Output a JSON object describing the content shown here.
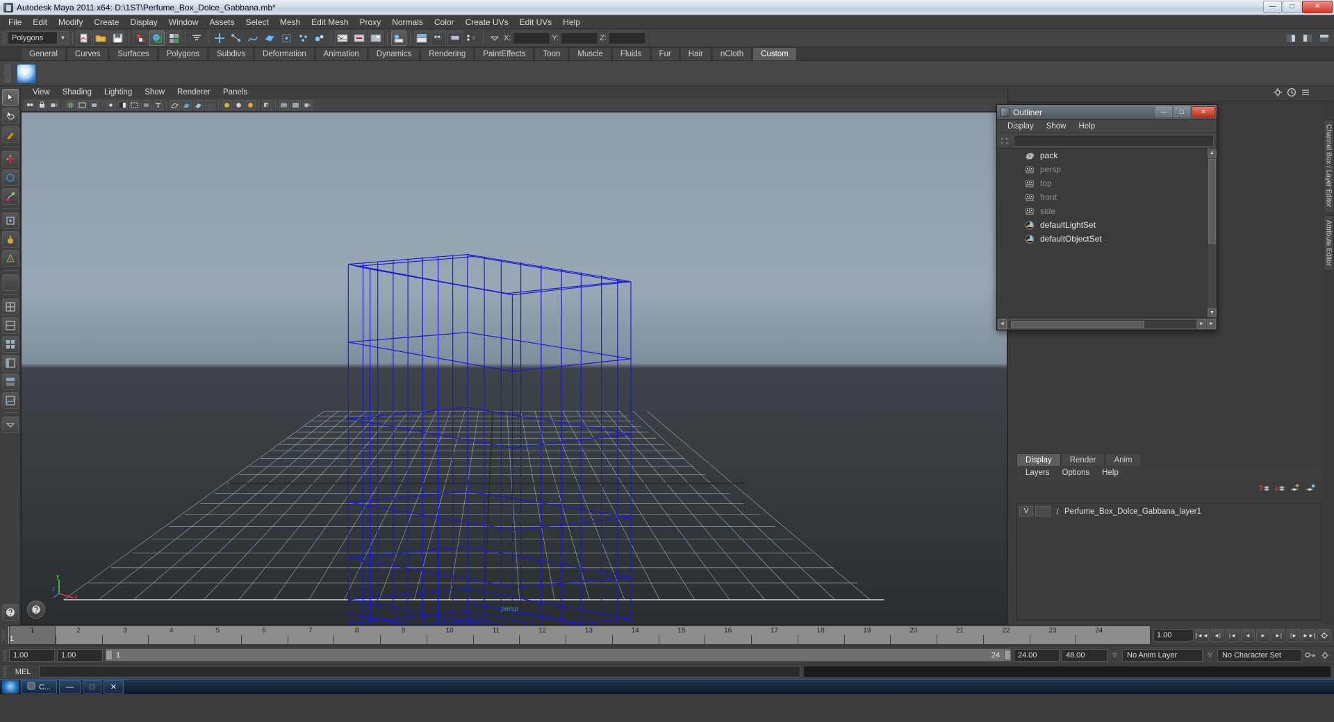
{
  "window": {
    "title": "Autodesk Maya 2011 x64: D:\\1ST\\Perfume_Box_Dolce_Gabbana.mb*",
    "app_icon": "maya-icon",
    "minimize": "—",
    "maximize": "□",
    "close": "✕"
  },
  "menubar": {
    "items": [
      "File",
      "Edit",
      "Modify",
      "Create",
      "Display",
      "Window",
      "Assets",
      "Select",
      "Mesh",
      "Edit Mesh",
      "Proxy",
      "Normals",
      "Color",
      "Create UVs",
      "Edit UVs",
      "Help"
    ]
  },
  "statusline": {
    "mode_menu": {
      "value": "Polygons",
      "arrow": "▼"
    },
    "coordinates": [
      {
        "label": "X:",
        "value": ""
      },
      {
        "label": "Y:",
        "value": ""
      },
      {
        "label": "Z:",
        "value": ""
      }
    ]
  },
  "shelf": {
    "tabs": [
      "General",
      "Curves",
      "Surfaces",
      "Polygons",
      "Subdivs",
      "Deformation",
      "Animation",
      "Dynamics",
      "Rendering",
      "PaintEffects",
      "Toon",
      "Muscle",
      "Fluids",
      "Fur",
      "Hair",
      "nCloth",
      "Custom"
    ],
    "active_tab": "Custom",
    "buttons": [
      {
        "name": "custom-check-button",
        "glyph": "✓"
      }
    ]
  },
  "viewport": {
    "menus": [
      "View",
      "Shading",
      "Lighting",
      "Show",
      "Renderer",
      "Panels"
    ],
    "camera_label": "persp",
    "axis": {
      "x": "x",
      "y": "y",
      "z": "z"
    },
    "object_color": "#1718d8",
    "grid_color": "#9aa7b4",
    "bg_top": "#8e9cab",
    "bg_bottom": "#2a2e31"
  },
  "outliner": {
    "title": "Outliner",
    "window_buttons": {
      "minimize": "—",
      "maximize": "□",
      "close": "✕"
    },
    "menus": [
      "Display",
      "Show",
      "Help"
    ],
    "search_value": "",
    "items": [
      {
        "label": "pack",
        "icon": "mesh-icon",
        "dim": false
      },
      {
        "label": "persp",
        "icon": "camera-icon",
        "dim": true
      },
      {
        "label": "top",
        "icon": "camera-icon",
        "dim": true
      },
      {
        "label": "front",
        "icon": "camera-icon",
        "dim": true
      },
      {
        "label": "side",
        "icon": "camera-icon",
        "dim": true
      },
      {
        "label": "defaultLightSet",
        "icon": "set-icon",
        "dim": false
      },
      {
        "label": "defaultObjectSet",
        "icon": "set-icon",
        "dim": false
      }
    ],
    "scroll_up": "▲",
    "scroll_down": "▼",
    "scroll_left": "◄",
    "scroll_right": "►"
  },
  "right_panel": {
    "vertical_tabs": [
      "Channel Box / Layer Editor",
      "Attribute Editor"
    ]
  },
  "layer_editor": {
    "tabs": [
      "Display",
      "Render",
      "Anim"
    ],
    "active_tab": "Display",
    "menus": [
      "Layers",
      "Options",
      "Help"
    ],
    "layers": [
      {
        "visibility": "V",
        "shading": "",
        "name": "Perfume_Box_Dolce_Gabbana_layer1"
      }
    ]
  },
  "timeline": {
    "ticks": [
      "1",
      "2",
      "3",
      "4",
      "5",
      "6",
      "7",
      "8",
      "9",
      "10",
      "11",
      "12",
      "13",
      "14",
      "15",
      "16",
      "17",
      "18",
      "19",
      "20",
      "21",
      "22",
      "23",
      "24"
    ],
    "current_frame": "1",
    "current_frame_field": "1.00",
    "playback_buttons": [
      "|◄◄",
      "◄|",
      "|◄",
      "◄",
      "►",
      "►|",
      "|►",
      "►►|"
    ]
  },
  "range": {
    "start_field": "1.00",
    "end_field": "1.00",
    "slider_start": "1",
    "slider_end": "24",
    "anim_start": "24.00",
    "anim_end": "48.00",
    "anim_layer": "No Anim Layer",
    "character_set": "No Character Set",
    "dropdown_arrow": "▽",
    "key_icon": "key-icon"
  },
  "command_line": {
    "label": "MEL",
    "input_value": "",
    "result_value": ""
  },
  "taskbar": {
    "start": "start-orb",
    "items": [
      {
        "label": "C...",
        "icon": "maya-taskbar-icon"
      }
    ],
    "window_buttons": {
      "minimize": "—",
      "restore": "□",
      "close": "✕"
    }
  }
}
